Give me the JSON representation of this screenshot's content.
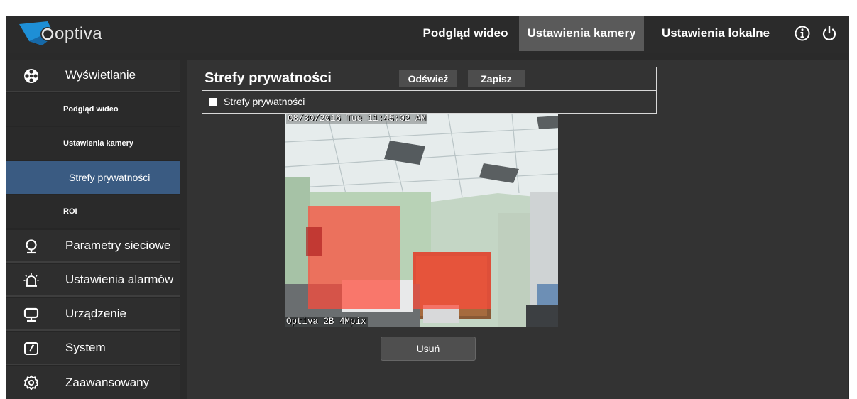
{
  "brand": {
    "logo_text": "optiva"
  },
  "topnav": {
    "items": [
      {
        "label": "Podgląd wideo"
      },
      {
        "label": "Ustawienia kamery",
        "active": true
      },
      {
        "label": "Ustawienia lokalne"
      }
    ],
    "info_icon": "info-icon",
    "power_icon": "power-icon"
  },
  "sidebar": {
    "sections": [
      {
        "label": "Wyświetlanie",
        "icon": "display-icon"
      },
      {
        "label": "Parametry sieciowe",
        "icon": "network-icon"
      },
      {
        "label": "Ustawienia alarmów",
        "icon": "alarm-icon"
      },
      {
        "label": "Urządzenie",
        "icon": "device-icon"
      },
      {
        "label": "System",
        "icon": "system-icon"
      },
      {
        "label": "Zaawansowany",
        "icon": "gear-icon"
      }
    ],
    "subitems": [
      {
        "label": "Podgląd wideo"
      },
      {
        "label": "Ustawienia kamery"
      },
      {
        "label": "Strefy prywatności",
        "active": true
      },
      {
        "label": "ROI"
      }
    ]
  },
  "panel": {
    "title": "Strefy prywatności",
    "refresh_label": "Odśwież",
    "save_label": "Zapisz",
    "checkbox_label": "Strefy prywatności",
    "checkbox_checked": false
  },
  "video": {
    "osd_top": "08/30/2016 Tue 11:45:02 AM",
    "osd_bottom": "Optiva 2B 4Mpix",
    "privacy_mask_color": "#ff4b3a"
  },
  "actions": {
    "delete_label": "Usuń"
  },
  "colors": {
    "accent": "#3a5b82",
    "logo_blue": "#1e8fd6"
  }
}
